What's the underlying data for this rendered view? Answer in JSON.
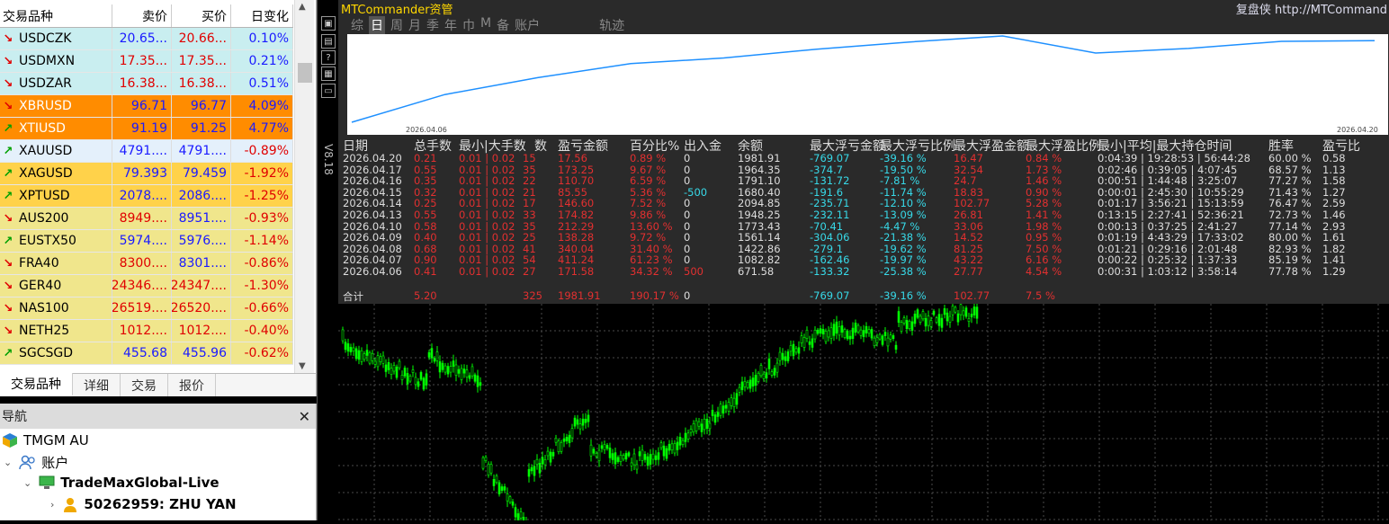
{
  "market_watch": {
    "headers": [
      "交易品种",
      "卖价",
      "买价",
      "日变化"
    ],
    "rows": [
      {
        "symbol": "USDCZK",
        "bid": "20.65...",
        "ask": "20.66...",
        "change": "0.10%",
        "dir": "down",
        "bg": "#c9eef0",
        "bidColor": "#1a1aff",
        "askColor": "#e00000",
        "chgColor": "#1a1aff",
        "symColor": "#000"
      },
      {
        "symbol": "USDMXN",
        "bid": "17.35...",
        "ask": "17.35...",
        "change": "0.21%",
        "dir": "down",
        "bg": "#c9eef0",
        "bidColor": "#e00000",
        "askColor": "#e00000",
        "chgColor": "#1a1aff",
        "symColor": "#000"
      },
      {
        "symbol": "USDZAR",
        "bid": "16.38...",
        "ask": "16.38...",
        "change": "0.51%",
        "dir": "down",
        "bg": "#c9eef0",
        "bidColor": "#e00000",
        "askColor": "#e00000",
        "chgColor": "#1a1aff",
        "symColor": "#000"
      },
      {
        "symbol": "XBRUSD",
        "bid": "96.71",
        "ask": "96.77",
        "change": "4.09%",
        "dir": "down",
        "bg": "#ff8c00",
        "bidColor": "#1a1aff",
        "askColor": "#1a1aff",
        "chgColor": "#1a1aff",
        "symColor": "#fff"
      },
      {
        "symbol": "XTIUSD",
        "bid": "91.19",
        "ask": "91.25",
        "change": "4.77%",
        "dir": "up",
        "bg": "#ff8c00",
        "bidColor": "#1a1aff",
        "askColor": "#1a1aff",
        "chgColor": "#1a1aff",
        "symColor": "#fff"
      },
      {
        "symbol": "XAUUSD",
        "bid": "4791....",
        "ask": "4791....",
        "change": "-0.89%",
        "dir": "up",
        "bg": "#e4f0fb",
        "bidColor": "#1a1aff",
        "askColor": "#1a1aff",
        "chgColor": "#e00000",
        "symColor": "#000"
      },
      {
        "symbol": "XAGUSD",
        "bid": "79.393",
        "ask": "79.459",
        "change": "-1.92%",
        "dir": "up",
        "bg": "#ffd24a",
        "bidColor": "#1a1aff",
        "askColor": "#1a1aff",
        "chgColor": "#e00000",
        "symColor": "#000"
      },
      {
        "symbol": "XPTUSD",
        "bid": "2078....",
        "ask": "2086....",
        "change": "-1.25%",
        "dir": "up",
        "bg": "#ffd24a",
        "bidColor": "#1a1aff",
        "askColor": "#1a1aff",
        "chgColor": "#e00000",
        "symColor": "#000"
      },
      {
        "symbol": "AUS200",
        "bid": "8949....",
        "ask": "8951....",
        "change": "-0.93%",
        "dir": "down",
        "bg": "#f0e68c",
        "bidColor": "#e00000",
        "askColor": "#1a1aff",
        "chgColor": "#e00000",
        "symColor": "#000"
      },
      {
        "symbol": "EUSTX50",
        "bid": "5974....",
        "ask": "5976....",
        "change": "-1.14%",
        "dir": "up",
        "bg": "#f0e68c",
        "bidColor": "#1a1aff",
        "askColor": "#1a1aff",
        "chgColor": "#e00000",
        "symColor": "#000"
      },
      {
        "symbol": "FRA40",
        "bid": "8300....",
        "ask": "8301....",
        "change": "-0.86%",
        "dir": "down",
        "bg": "#f0e68c",
        "bidColor": "#e00000",
        "askColor": "#1a1aff",
        "chgColor": "#e00000",
        "symColor": "#000"
      },
      {
        "symbol": "GER40",
        "bid": "24346....",
        "ask": "24347....",
        "change": "-1.30%",
        "dir": "down",
        "bg": "#f0e68c",
        "bidColor": "#e00000",
        "askColor": "#e00000",
        "chgColor": "#e00000",
        "symColor": "#000"
      },
      {
        "symbol": "NAS100",
        "bid": "26519....",
        "ask": "26520....",
        "change": "-0.66%",
        "dir": "down",
        "bg": "#f0e68c",
        "bidColor": "#e00000",
        "askColor": "#e00000",
        "chgColor": "#e00000",
        "symColor": "#000"
      },
      {
        "symbol": "NETH25",
        "bid": "1012....",
        "ask": "1012....",
        "change": "-0.40%",
        "dir": "down",
        "bg": "#f0e68c",
        "bidColor": "#e00000",
        "askColor": "#e00000",
        "chgColor": "#e00000",
        "symColor": "#000"
      },
      {
        "symbol": "SGCSGD",
        "bid": "455.68",
        "ask": "455.96",
        "change": "-0.62%",
        "dir": "up",
        "bg": "#f0e68c",
        "bidColor": "#1a1aff",
        "askColor": "#1a1aff",
        "chgColor": "#e00000",
        "symColor": "#000"
      }
    ],
    "tabs": [
      "交易品种",
      "详细",
      "交易",
      "报价"
    ]
  },
  "navigator": {
    "title": "导航",
    "broker": "TMGM AU",
    "accounts_label": "账户",
    "server": "TradeMaxGlobal-Live",
    "account": "50262959: ZHU YAN"
  },
  "mtc": {
    "title": "MTCommander资管",
    "right": "复盘侠 http://MTCommand",
    "tabs": [
      "综",
      "日",
      "周",
      "月",
      "季",
      "年",
      "巾",
      "M",
      "备",
      "账户",
      "轨迹"
    ],
    "active_tab": "日",
    "side_version": "V8.18",
    "equity_start_date": "2026.04.06",
    "equity_end_date": "2026.04.20",
    "headers": [
      "日期",
      "总手数",
      "最小|大手数",
      "数",
      "盈亏金额",
      "百分比%",
      "出入金",
      "余额",
      "最大浮亏金额",
      "最大浮亏比例",
      "最大浮盈金额",
      "最大浮盈比例",
      "最小|平均|最大持仓时间",
      "胜率",
      "盈亏比"
    ],
    "rows": [
      [
        "2026.04.20",
        "0.21",
        "0.01 | 0.02",
        "15",
        "17.56",
        "0.89 %",
        "0",
        "1981.91",
        "-769.07",
        "-39.16 %",
        "16.47",
        "0.84 %",
        "0:04:39 | 19:28:53 | 56:44:28",
        "60.00 %",
        "0.58"
      ],
      [
        "2026.04.17",
        "0.55",
        "0.01 | 0.02",
        "35",
        "173.25",
        "9.67 %",
        "0",
        "1964.35",
        "-374.7",
        "-19.50 %",
        "32.54",
        "1.73 %",
        "0:02:46 | 0:39:05 | 4:07:45",
        "68.57 %",
        "1.13"
      ],
      [
        "2026.04.16",
        "0.35",
        "0.01 | 0.02",
        "22",
        "110.70",
        "6.59 %",
        "0",
        "1791.10",
        "-131.72",
        "-7.81 %",
        "24.7",
        "1.46 %",
        "0:00:51 | 1:44:48 | 3:25:07",
        "77.27 %",
        "1.58"
      ],
      [
        "2026.04.15",
        "0.32",
        "0.01 | 0.02",
        "21",
        "85.55",
        "5.36 %",
        "-500",
        "1680.40",
        "-191.6",
        "-11.74 %",
        "18.83",
        "0.90 %",
        "0:00:01 | 2:45:30 | 10:55:29",
        "71.43 %",
        "1.27"
      ],
      [
        "2026.04.14",
        "0.25",
        "0.01 | 0.02",
        "17",
        "146.60",
        "7.52 %",
        "0",
        "2094.85",
        "-235.71",
        "-12.10 %",
        "102.77",
        "5.28 %",
        "0:01:17 | 3:56:21 | 15:13:59",
        "76.47 %",
        "2.59"
      ],
      [
        "2026.04.13",
        "0.55",
        "0.01 | 0.02",
        "33",
        "174.82",
        "9.86 %",
        "0",
        "1948.25",
        "-232.11",
        "-13.09 %",
        "26.81",
        "1.41 %",
        "0:13:15 | 2:27:41 | 52:36:21",
        "72.73 %",
        "1.46"
      ],
      [
        "2026.04.10",
        "0.58",
        "0.01 | 0.02",
        "35",
        "212.29",
        "13.60 %",
        "0",
        "1773.43",
        "-70.41",
        "-4.47 %",
        "33.06",
        "1.98 %",
        "0:00:13 | 0:37:25 | 2:41:27",
        "77.14 %",
        "2.93"
      ],
      [
        "2026.04.09",
        "0.40",
        "0.01 | 0.02",
        "25",
        "138.28",
        "9.72 %",
        "0",
        "1561.14",
        "-304.06",
        "-21.38 %",
        "14.52",
        "0.95 %",
        "0:01:19 | 4:43:29 | 17:33:02",
        "80.00 %",
        "1.61"
      ],
      [
        "2026.04.08",
        "0.68",
        "0.01 | 0.02",
        "41",
        "340.04",
        "31.40 %",
        "0",
        "1422.86",
        "-279.1",
        "-19.62 %",
        "81.25",
        "7.50 %",
        "0:01:21 | 0:29:16 | 2:01:48",
        "82.93 %",
        "1.82"
      ],
      [
        "2026.04.07",
        "0.90",
        "0.01 | 0.02",
        "54",
        "411.24",
        "61.23 %",
        "0",
        "1082.82",
        "-162.46",
        "-19.97 %",
        "43.22",
        "6.16 %",
        "0:00:22 | 0:25:32 | 1:37:33",
        "85.19 %",
        "1.41"
      ],
      [
        "2026.04.06",
        "0.41",
        "0.01 | 0.02",
        "27",
        "171.58",
        "34.32 %",
        "500",
        "671.58",
        "-133.32",
        "-25.38 %",
        "27.77",
        "4.54 %",
        "0:00:31 | 1:03:12 | 3:58:14",
        "77.78 %",
        "1.29"
      ]
    ],
    "total": [
      "合计",
      "5.20",
      "",
      "325",
      "1981.91",
      "190.17 %",
      "0",
      "",
      "-769.07",
      "-39.16 %",
      "102.77",
      "7.5 %",
      "",
      "",
      ""
    ]
  },
  "colors": {
    "up_arrow": "#00a000",
    "down_arrow": "#e00000",
    "candles": "#00ff00",
    "equity_line": "#1e90ff"
  }
}
